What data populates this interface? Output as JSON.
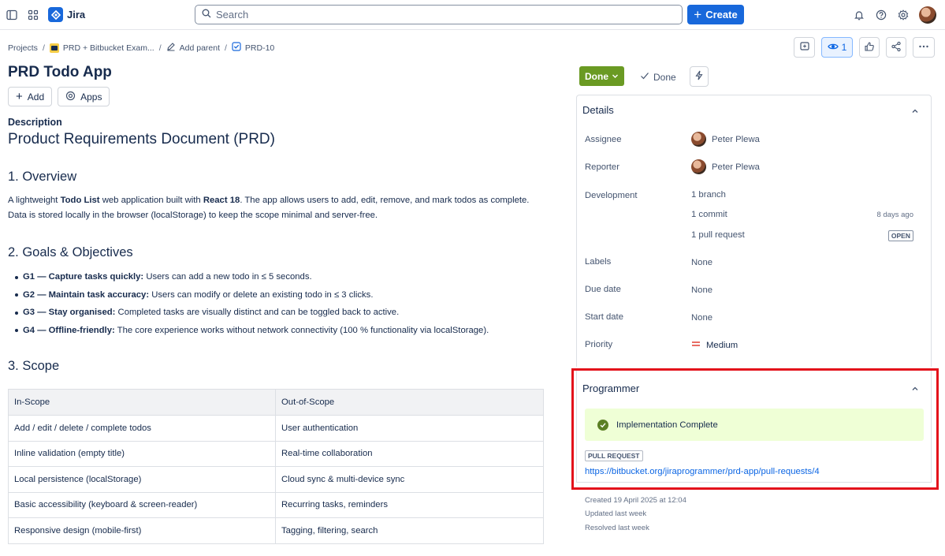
{
  "topbar": {
    "app_name": "Jira",
    "search_placeholder": "Search",
    "create_label": "Create"
  },
  "breadcrumb": {
    "projects": "Projects",
    "project": "PRD + Bitbucket Exam...",
    "add_parent": "Add parent",
    "issue_key": "PRD-10"
  },
  "issue": {
    "title": "PRD Todo App",
    "add_label": "Add",
    "apps_label": "Apps",
    "watch_count": "1"
  },
  "description": {
    "label": "Description",
    "heading": "Product Requirements Document (PRD)",
    "overview_heading": "1. Overview",
    "overview": {
      "p1": "A lightweight ",
      "b1": "Todo List",
      "p2": " web application built with ",
      "b2": "React 18",
      "p3": ". The app allows users to add, edit, remove, and mark todos as complete. Data is stored locally in the browser (localStorage) to keep the scope minimal and server-free."
    },
    "goals_heading": "2. Goals & Objectives",
    "goals": [
      {
        "bold": "G1 — Capture tasks quickly:",
        "text": " Users can add a new todo in ≤ 5 seconds."
      },
      {
        "bold": "G2 — Maintain task accuracy:",
        "text": " Users can modify or delete an existing todo in ≤ 3 clicks."
      },
      {
        "bold": "G3 — Stay organised:",
        "text": " Completed tasks are visually distinct and can be toggled back to active."
      },
      {
        "bold": "G4 — Offline-friendly:",
        "text": " The core experience works without network connectivity (100 % functionality via localStorage)."
      }
    ],
    "scope_heading": "3. Scope",
    "scope_table": {
      "headers": [
        "In-Scope",
        "Out-of-Scope"
      ],
      "rows": [
        [
          "Add / edit / delete / complete todos",
          "User authentication"
        ],
        [
          "Inline validation (empty title)",
          "Real-time collaboration"
        ],
        [
          "Local persistence (localStorage)",
          "Cloud sync & multi-device sync"
        ],
        [
          "Basic accessibility (keyboard & screen-reader)",
          "Recurring tasks, reminders"
        ],
        [
          "Responsive design (mobile-first)",
          "Tagging, filtering, search"
        ]
      ]
    }
  },
  "status": {
    "label": "Done",
    "resolution": "Done",
    "color": "#6a9a23"
  },
  "details": {
    "heading": "Details",
    "assignee_label": "Assignee",
    "assignee": "Peter Plewa",
    "reporter_label": "Reporter",
    "reporter": "Peter Plewa",
    "development_label": "Development",
    "branch": "1 branch",
    "commit": "1 commit",
    "commit_time": "8 days ago",
    "pull_request": "1 pull request",
    "pr_status": "OPEN",
    "labels_label": "Labels",
    "labels": "None",
    "due_date_label": "Due date",
    "due_date": "None",
    "start_date_label": "Start date",
    "start_date": "None",
    "priority_label": "Priority",
    "priority": "Medium"
  },
  "programmer": {
    "heading": "Programmer",
    "status": "Implementation Complete",
    "badge": "PULL REQUEST",
    "link": "https://bitbucket.org/jiraprogrammer/prd-app/pull-requests/4"
  },
  "meta": {
    "created": "Created 19 April 2025 at 12:04",
    "updated": "Updated last week",
    "resolved": "Resolved last week"
  },
  "colors": {
    "brand": "#1868db",
    "highlight": "#e3121b",
    "success_bg": "#efffd6"
  }
}
